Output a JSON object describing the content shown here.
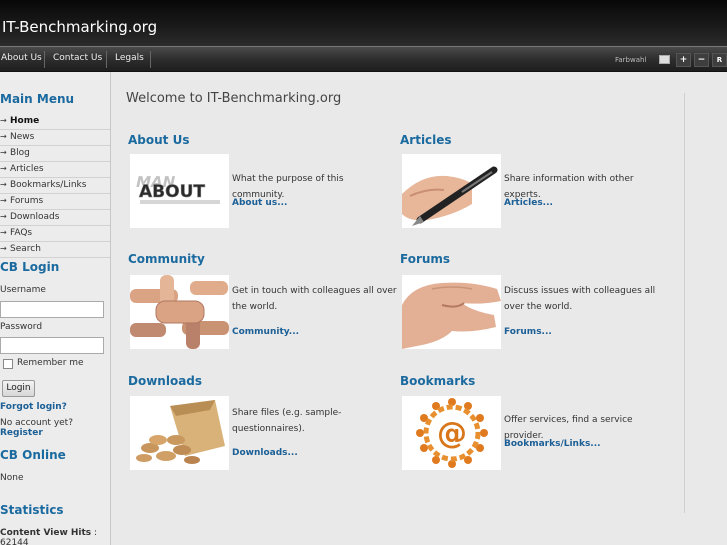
{
  "header": {
    "title": "IT-Benchmarking.org"
  },
  "nav": {
    "items": [
      {
        "label": "About Us"
      },
      {
        "label": "Contact Us"
      },
      {
        "label": "Legals"
      }
    ],
    "color_label": "Farbwahl",
    "buttons": [
      "+",
      "−",
      "R"
    ]
  },
  "sidebar": {
    "main_menu_title": "Main Menu",
    "menu": [
      {
        "label": "Home",
        "active": true
      },
      {
        "label": "News"
      },
      {
        "label": "Blog"
      },
      {
        "label": "Articles"
      },
      {
        "label": "Bookmarks/Links"
      },
      {
        "label": "Forums"
      },
      {
        "label": "Downloads"
      },
      {
        "label": "FAQs"
      },
      {
        "label": "Search"
      }
    ],
    "login": {
      "title": "CB Login",
      "username_label": "Username",
      "password_label": "Password",
      "remember_label": "Remember me",
      "login_button": "Login",
      "forgot": "Forgot login?",
      "no_account": "No account yet?",
      "register": "Register"
    },
    "online": {
      "title": "CB Online",
      "value": "None"
    },
    "stats": {
      "title": "Statistics",
      "label": "Content View Hits",
      "sep": " : ",
      "value": "62144"
    }
  },
  "main": {
    "welcome": "Welcome to IT-Benchmarking.org",
    "sections": {
      "about": {
        "title": "About Us",
        "text": "What the purpose of this community.",
        "link": "About us...",
        "icon": "about-text-3d-image"
      },
      "articles": {
        "title": "Articles",
        "text": "Share information with other experts.",
        "link": "Articles...",
        "icon": "fountain-pen-image"
      },
      "community": {
        "title": "Community",
        "text": "Get in touch with colleagues all over the world.",
        "link": "Community...",
        "icon": "linked-hands-image"
      },
      "forums": {
        "title": "Forums",
        "text": "Discuss issues with colleagues all over the world.",
        "link": "Forums...",
        "icon": "talking-hand-image"
      },
      "downloads": {
        "title": "Downloads",
        "text": "Share files (e.g. sample-questionnaires).",
        "link": "Downloads...",
        "icon": "peanuts-bag-image"
      },
      "bookmarks": {
        "title": "Bookmarks",
        "text": "Offer services, find a service provider.",
        "link": "Bookmarks/Links...",
        "icon": "at-sign-people-image"
      }
    }
  },
  "colors": {
    "accent": "#1b6a9f",
    "link": "#1b5f96",
    "header_bg": "#111111",
    "page_bg": "#e9e9e9"
  }
}
